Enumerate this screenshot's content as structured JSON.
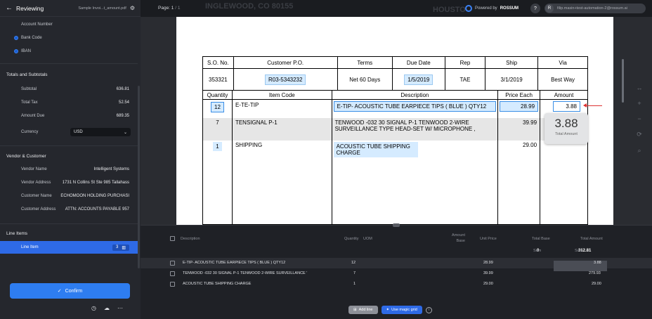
{
  "sidebar": {
    "title": "Reviewing",
    "file_name": "Sample Invoi...t_amount.pdf",
    "fields_top": [
      {
        "label": "Account Number",
        "value": ""
      },
      {
        "label": "Bank Code",
        "value": ""
      },
      {
        "label": "IBAN",
        "value": ""
      }
    ],
    "totals_heading": "Totals and Subtotals",
    "totals": [
      {
        "label": "Subtotal",
        "value": "636.81"
      },
      {
        "label": "Total Tax",
        "value": "52.54"
      },
      {
        "label": "Amount Due",
        "value": "689.35"
      }
    ],
    "currency_label": "Currency",
    "currency_value": "USD",
    "vendor_heading": "Vendor & Customer",
    "vendor": [
      {
        "label": "Vendor Name",
        "value": "Intelligent Systems"
      },
      {
        "label": "Vendor Address",
        "value": "1731 N Collins St Ste 985 Tallahass"
      },
      {
        "label": "Customer Name",
        "value": "ECHOMOON HOLDING PURCHASI"
      },
      {
        "label": "Customer Address",
        "value": "ATTN: ACCOUNTS PAYABLE 957"
      }
    ],
    "line_items_heading": "Line Items",
    "line_item_label": "Line Item",
    "line_item_count": "3",
    "confirm_label": "Confirm"
  },
  "topbar": {
    "page_label": "Page: 1",
    "page_total": "/ 1",
    "ghost_left": "INGLEWOOD, CO 80155",
    "ghost_right": "HOUSTO",
    "powered_prefix": "Powered by",
    "powered_brand": "ROSSUM",
    "help": "?",
    "avatar": "R",
    "user_email": "filip.masin+test-automation-2@rossum.ai"
  },
  "document": {
    "header_cols": [
      "S.O. No.",
      "Customer P.O.",
      "Terms",
      "Due Date",
      "Rep",
      "Ship",
      "Via"
    ],
    "header_vals": [
      "353321",
      "R03-5343232",
      "Net 60 Days",
      "1/5/2019",
      "TAE",
      "3/1/2019",
      "Best Way"
    ],
    "item_cols": [
      "Quantity",
      "Item Code",
      "Description",
      "Price Each",
      "Amount"
    ],
    "items": [
      {
        "qty": "12",
        "code": "E-TE-TIP",
        "desc": "E-TIP- ACOUSTIC TUBE EARPIECE TIPS ( BLUE ) QTY12",
        "price": "28.99",
        "amount": "3.88"
      },
      {
        "qty": "7",
        "code": "TENSIGNAL P-1",
        "desc": "TENWOOD -032 30 SIGNAL P-1 TENWOOD 2-WIRE SURVEILLANCE TYPE HEAD-SET W/ MICROPHONE ,",
        "price": "39.99",
        "amount": ""
      },
      {
        "qty": "1",
        "code": "SHIPPING",
        "desc": "ACOUSTIC TUBE SHIPPING CHARGE",
        "price": "29.00",
        "amount": ""
      }
    ],
    "tooltip_value": "3.88",
    "tooltip_label": "Total Amount"
  },
  "grid": {
    "columns": [
      "Description",
      "Quantity",
      "UOM",
      "Amount Base",
      "Unit Price",
      "Total Base",
      "Total Amount"
    ],
    "sum_label": "Sum",
    "sum_total_base": "0",
    "sum_total_amount": "312.81",
    "rows": [
      {
        "desc": "E-TIP- ACOUSTIC TUBE EARPIECE TIPS ( BLUE ) QTY12",
        "qty": "12",
        "unit_price": "28.99",
        "total_amount": "3.88"
      },
      {
        "desc": "TENWOOD -032 30 SIGNAL P-1 TENWOOD 2-WIRE SURVEILLANCE '",
        "qty": "7",
        "unit_price": "39.99",
        "total_amount": "279.93"
      },
      {
        "desc": "ACOUSTIC TUBE SHIPPING CHARGE",
        "qty": "1",
        "unit_price": "29.00",
        "total_amount": "29.00"
      }
    ],
    "add_line_label": "Add line",
    "magic_grid_label": "Use magic grid"
  },
  "colors": {
    "accent": "#2e6ae6",
    "sidebar_bg": "#25272d",
    "highlight": "#d5ebff"
  }
}
